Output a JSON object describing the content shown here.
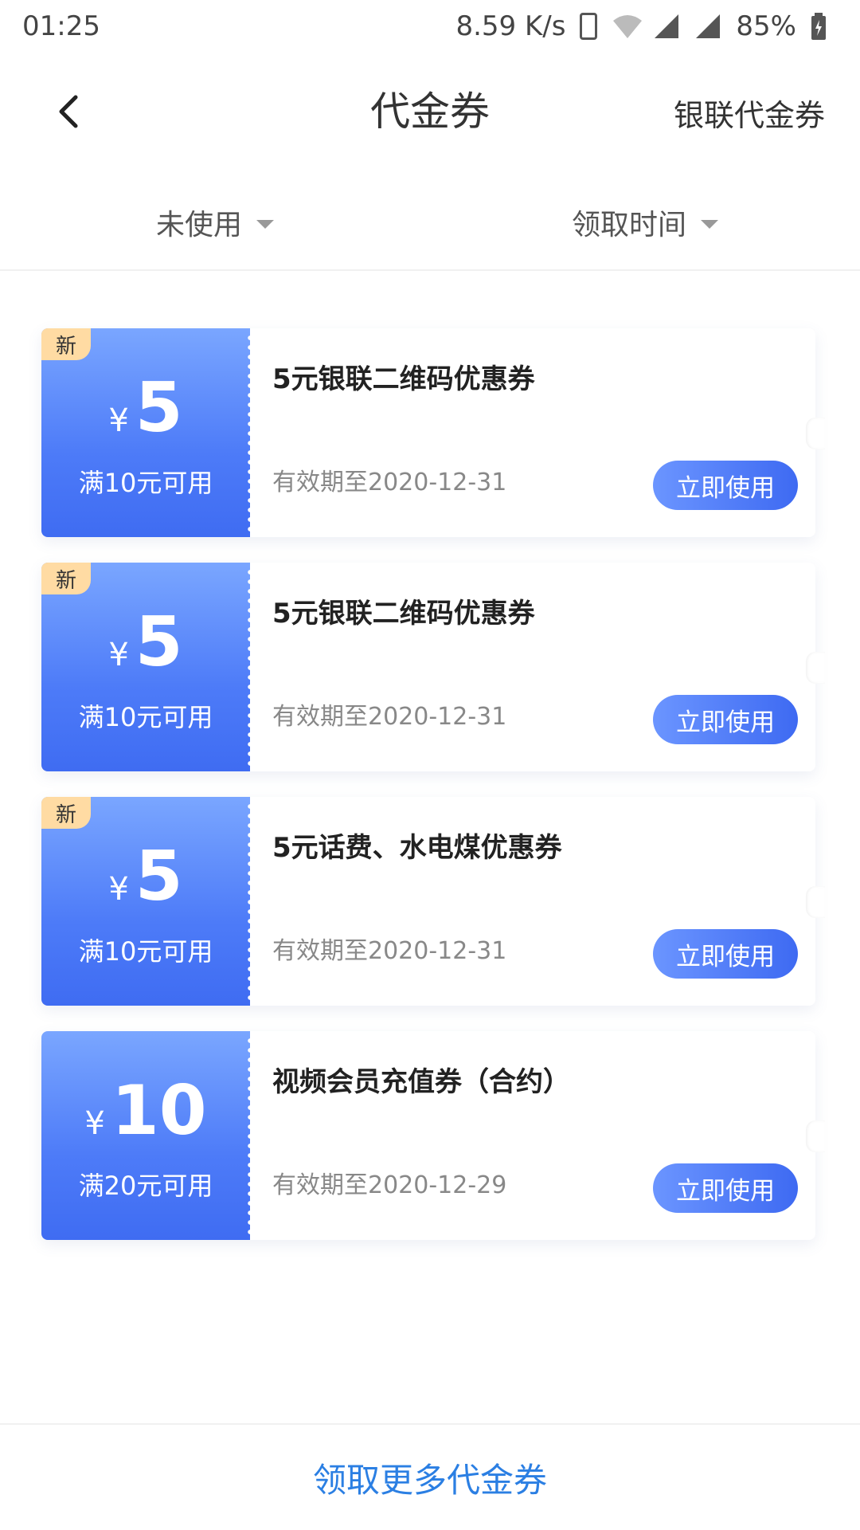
{
  "status_bar": {
    "time": "01:25",
    "network_speed": "8.59 K/s",
    "battery": "85%",
    "icons": [
      "vibrate-icon",
      "wifi-icon",
      "signal-icon",
      "signal-icon",
      "battery-icon"
    ]
  },
  "header": {
    "title": "代金券",
    "right_action": "银联代金券",
    "back_icon": "chevron-left-icon"
  },
  "filters": [
    {
      "label": "未使用",
      "icon": "caret-down-icon"
    },
    {
      "label": "领取时间",
      "icon": "caret-down-icon"
    }
  ],
  "coupons": [
    {
      "badge": "新",
      "currency": "¥",
      "amount": "5",
      "threshold": "满10元可用",
      "name": "5元银联二维码优惠券",
      "expiry": "有效期至2020-12-31",
      "button": "立即使用"
    },
    {
      "badge": "新",
      "currency": "¥",
      "amount": "5",
      "threshold": "满10元可用",
      "name": "5元银联二维码优惠券",
      "expiry": "有效期至2020-12-31",
      "button": "立即使用"
    },
    {
      "badge": "新",
      "currency": "¥",
      "amount": "5",
      "threshold": "满10元可用",
      "name": "5元话费、水电煤优惠券",
      "expiry": "有效期至2020-12-31",
      "button": "立即使用"
    },
    {
      "badge": "",
      "currency": "¥",
      "amount": "10",
      "threshold": "满20元可用",
      "name": "视频会员充值券（合约）",
      "expiry": "有效期至2020-12-29",
      "button": "立即使用"
    }
  ],
  "bottom": {
    "link": "领取更多代金券"
  },
  "colors": {
    "accent_blue": "#4d7bf8",
    "badge_orange": "#ffdba3",
    "link_blue": "#2b7fe3"
  }
}
